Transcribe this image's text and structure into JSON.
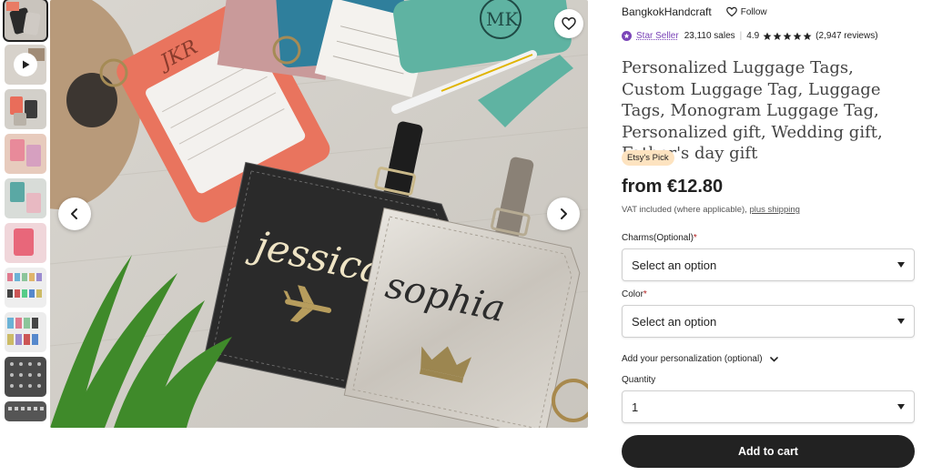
{
  "shop": {
    "name": "BangkokHandcraft",
    "follow_label": "Follow"
  },
  "meta": {
    "badge": "Star Seller",
    "sales": "23,110 sales",
    "rating": "4.9",
    "reviews": "(2,947 reviews)",
    "stars": 5
  },
  "product": {
    "title": "Personalized Luggage Tags, Custom Luggage Tag, Luggage Tags, Monogram Luggage Tag, Personalized gift, Wedding gift, Father's day gift",
    "pick_badge": "Etsy's Pick",
    "price": "from €12.80",
    "vat_text": "VAT included (where applicable),",
    "shipping_link": "plus shipping"
  },
  "photo_text": {
    "tag1": "jessica",
    "tag2": "sophia",
    "initials": "MK",
    "initials2": "JKR"
  },
  "options": {
    "charms_label": "Charms(Optional)",
    "charms_value": "Select an option",
    "color_label": "Color",
    "color_value": "Select an option",
    "personalization_label": "Add your personalization (optional)",
    "quantity_label": "Quantity",
    "quantity_value": "1"
  },
  "cart": {
    "label": "Add to cart"
  },
  "thumbnails": [
    "photo",
    "video",
    "photo",
    "photo",
    "photo",
    "photo",
    "photo",
    "photo",
    "photo",
    "photo"
  ],
  "colors": {
    "accent": "#7b45b8",
    "button": "#222222",
    "pick_bg": "#fde3c0",
    "required": "#b11c1c"
  }
}
